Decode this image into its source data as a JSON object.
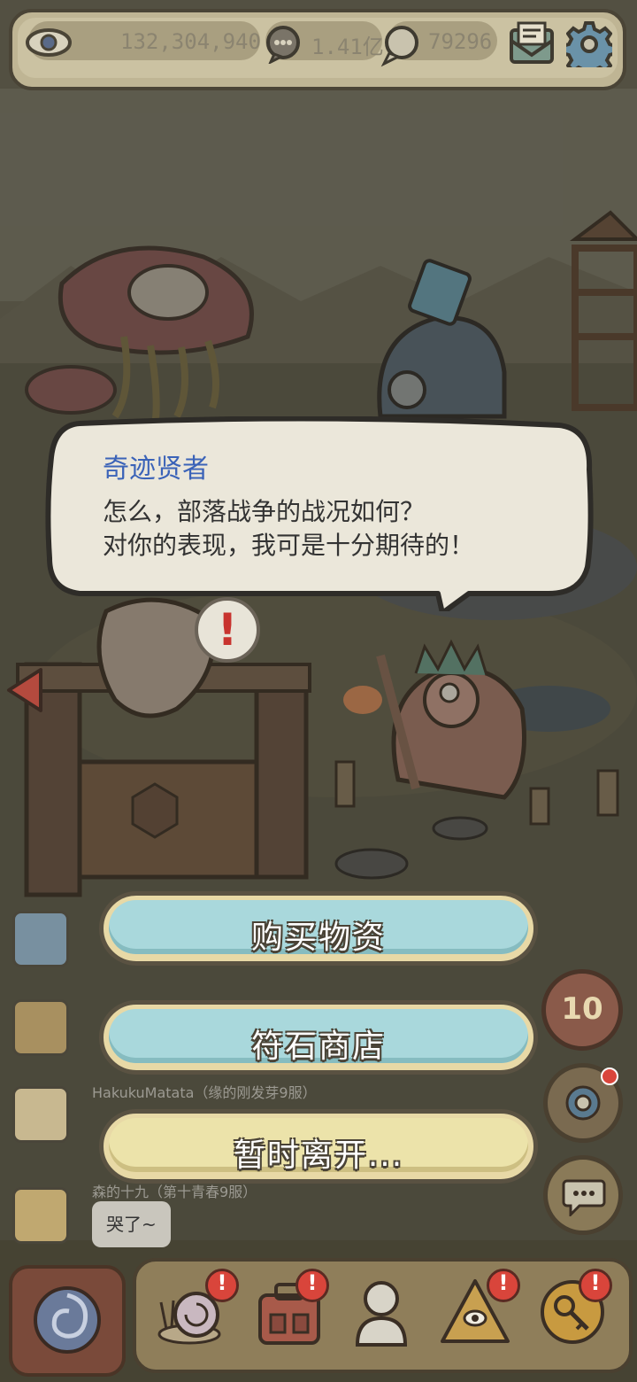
{
  "topbar": {
    "eye_count": "132,304,940",
    "currency_1": "1.41亿",
    "currency_2": "79296"
  },
  "dialog": {
    "speaker": "奇迹贤者",
    "line_1": "怎么，部落战争的战况如何？",
    "line_2": "对你的表现，我可是十分期待的！",
    "alert_mark": "!"
  },
  "menu": {
    "buy_supplies": "购买物资",
    "rune_shop": "符石商店",
    "leave": "暂时离开..."
  },
  "chat": {
    "name_2": "HakukuMatata（缘的刚发芽9服）",
    "name_3": "森的十九（第十青春9服）",
    "message_3": "哭了~"
  },
  "widgets": {
    "counter_value": "10"
  },
  "bottom": {
    "badge": "!"
  },
  "colors": {
    "accent_blue": "#3b63b8",
    "button_blue": "#a9d8dc",
    "button_yellow": "#ece3aa",
    "badge_red": "#d9453b"
  },
  "icons": [
    "eye-icon",
    "message-bubble-icon",
    "chat-bubble-icon",
    "mail-icon",
    "gear-icon",
    "back-arrow-icon",
    "snail-icon",
    "backpack-icon",
    "statue-icon",
    "pyramid-icon",
    "key-icon",
    "portal-icon",
    "target-icon",
    "chat-icon"
  ]
}
